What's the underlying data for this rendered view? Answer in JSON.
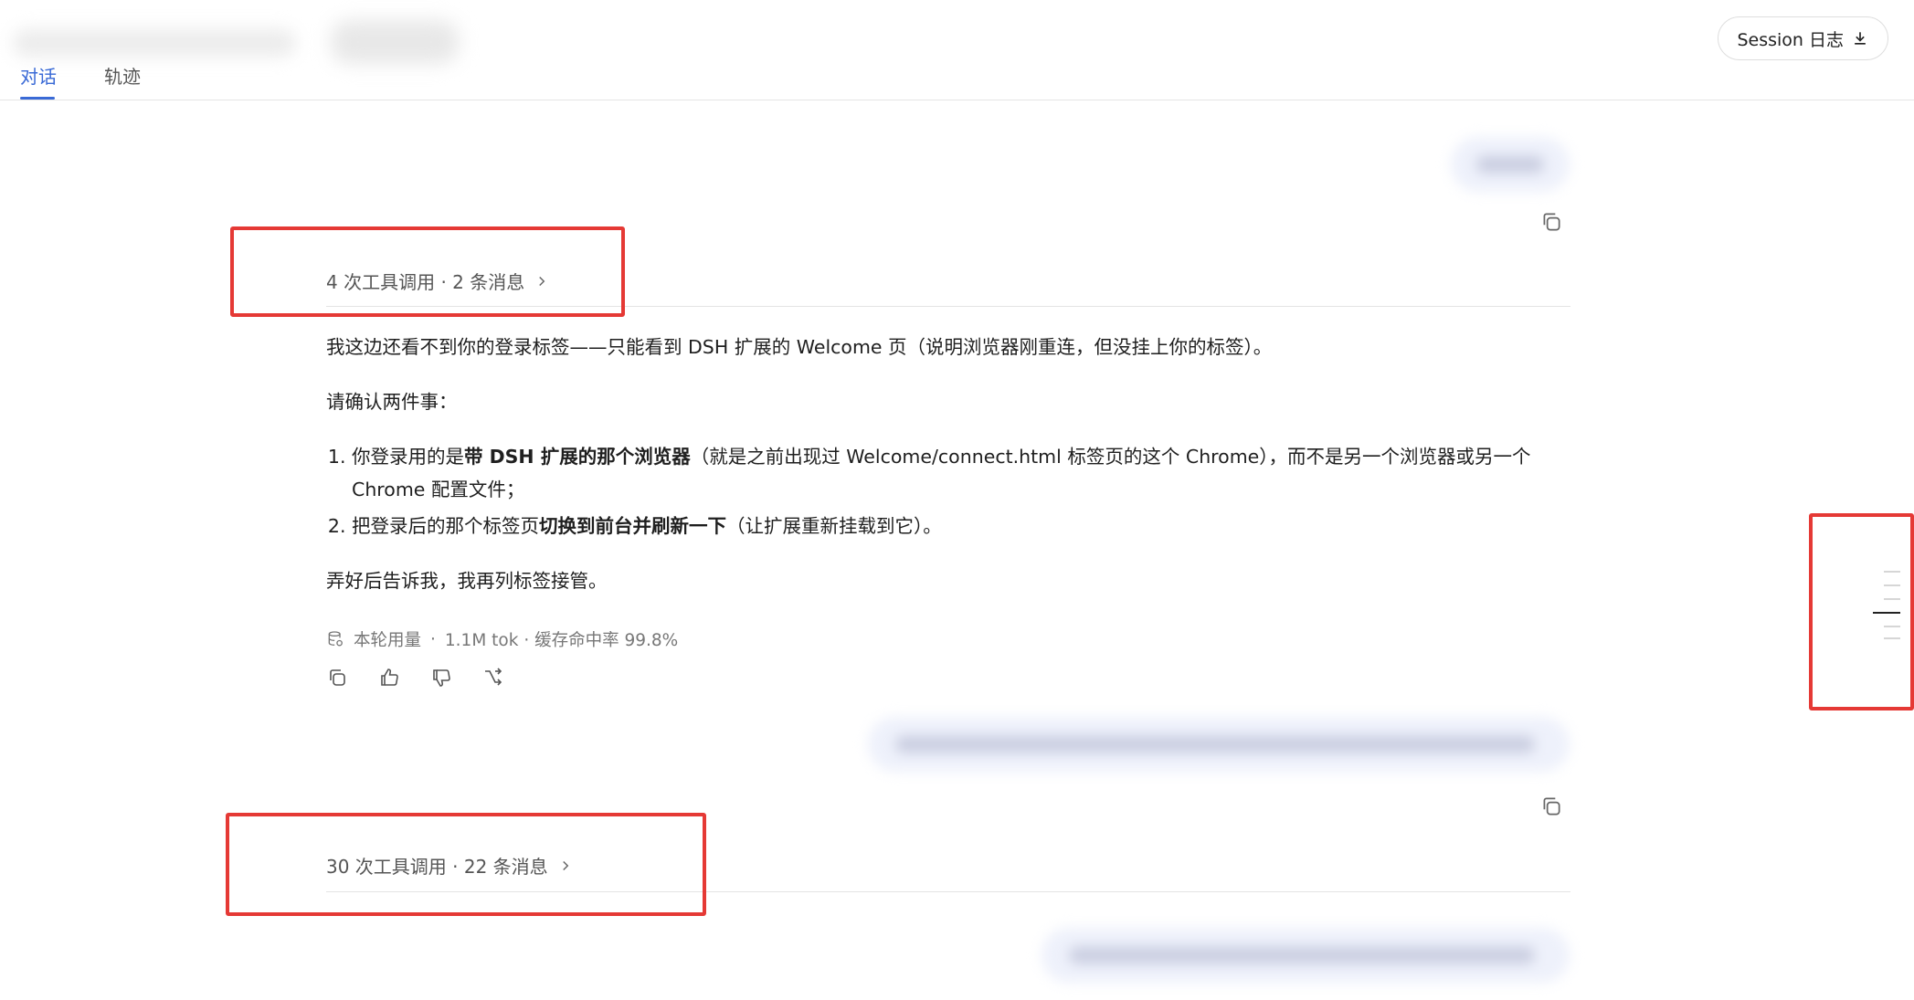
{
  "header": {
    "tabs": [
      {
        "label": "对话",
        "active": true
      },
      {
        "label": "轨迹",
        "active": false
      }
    ],
    "session_button_label": "Session 日志",
    "accent_color": "#3a6ad6"
  },
  "conversation": {
    "first_group": {
      "summary": "4 次工具调用 · 2 条消息"
    },
    "reply": {
      "paragraph1": "我这边还看不到你的登录标签——只能看到 DSH 扩展的 Welcome 页（说明浏览器刚重连，但没挂上你的标签）。",
      "paragraph2": "请确认两件事：",
      "item1_pre": "你登录用的是",
      "item1_bold": "带 DSH 扩展的那个浏览器",
      "item1_post": "（就是之前出现过 Welcome/connect.html 标签页的这个 Chrome），而不是另一个浏览器或另一个 Chrome 配置文件；",
      "item2_pre": "把登录后的那个标签页",
      "item2_bold": "切换到前台并刷新一下",
      "item2_post": "（让扩展重新挂载到它）。",
      "paragraph3": "弄好后告诉我，我再列标签接管。"
    },
    "usage": {
      "label": "本轮用量",
      "separator": "·",
      "detail": "1.1M tok · 缓存命中率 99.8%"
    },
    "second_group": {
      "summary": "30 次工具调用 · 22 条消息"
    }
  },
  "highlight_color": "#e53935"
}
